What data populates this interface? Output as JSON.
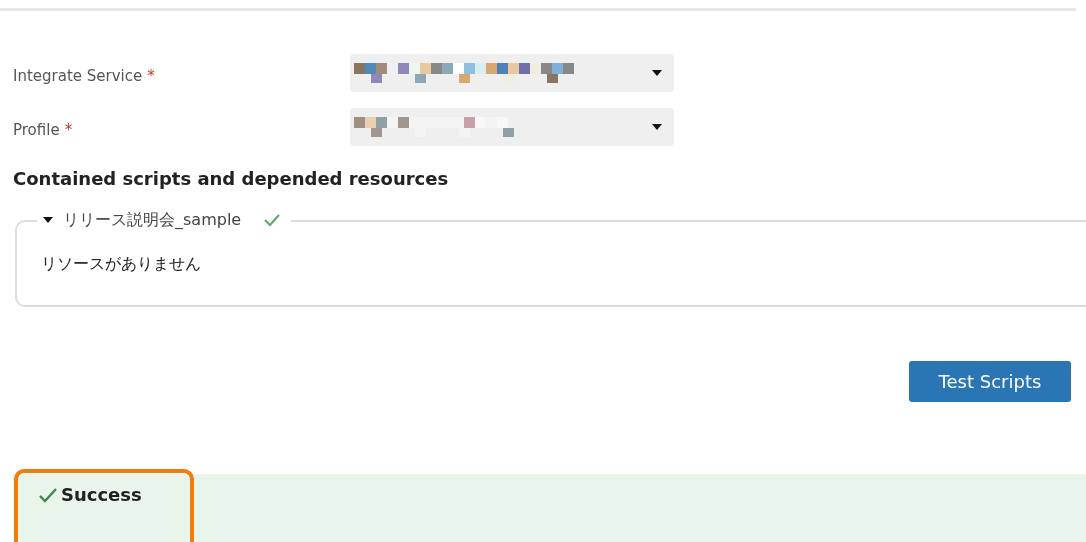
{
  "fields": [
    {
      "label": "Integrate Service",
      "required_mark": "*"
    },
    {
      "label": "Profile",
      "required_mark": "*"
    }
  ],
  "section_title": "Contained scripts and depended resources",
  "script_group": {
    "name": "リリース説明会_sample",
    "expanded": true,
    "passed": true,
    "empty_message": "リソースがありません"
  },
  "test_button": "Test Scripts",
  "result": {
    "kind": "success",
    "text": "Success",
    "highlighted": true
  }
}
